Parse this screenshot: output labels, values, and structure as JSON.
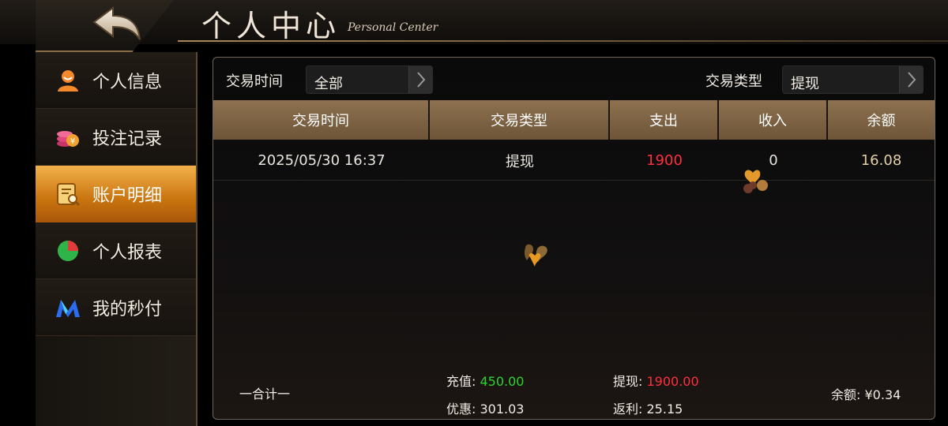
{
  "header": {
    "title_zh": "个人中心",
    "title_en": "Personal Center",
    "back_icon": "back-arrow-icon"
  },
  "sidebar": {
    "items": [
      {
        "label": "个人信息",
        "icon": "user-icon",
        "active": false
      },
      {
        "label": "投注记录",
        "icon": "coins-icon",
        "active": false
      },
      {
        "label": "账户明细",
        "icon": "document-search-icon",
        "active": true
      },
      {
        "label": "个人报表",
        "icon": "pie-chart-icon",
        "active": false
      },
      {
        "label": "我的秒付",
        "icon": "m-logo-icon",
        "active": false
      }
    ]
  },
  "filters": {
    "time_label": "交易时间",
    "time_value": "全部",
    "type_label": "交易类型",
    "type_value": "提现"
  },
  "table": {
    "headers": [
      "交易时间",
      "交易类型",
      "支出",
      "收入",
      "余额"
    ],
    "rows": [
      {
        "time": "2025/05/30 16:37",
        "type": "提现",
        "expense": "1900",
        "income": "0",
        "balance": "16.08"
      }
    ]
  },
  "summary": {
    "label": "一合计一",
    "recharge_label": "充值:",
    "recharge_value": "450.00",
    "withdraw_label": "提现:",
    "withdraw_value": "1900.00",
    "discount_label": "优惠:",
    "discount_value": "301.03",
    "rebate_label": "返利:",
    "rebate_value": "25.15",
    "balance_label": "余额:",
    "balance_value": "¥0.34"
  },
  "colors": {
    "accent_orange": "#e8981f",
    "header_gold": "#8d7150",
    "positive_green": "#2bd42b",
    "negative_red": "#ff2f3f"
  }
}
